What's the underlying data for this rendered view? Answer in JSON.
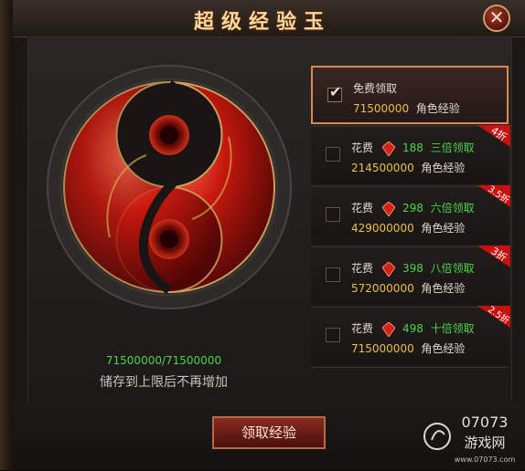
{
  "window": {
    "title": "超级经验玉",
    "close_label": "✕"
  },
  "exp_jade": {
    "progress": "71500000/71500000",
    "note": "储存到上限后不再增加"
  },
  "options": [
    {
      "selected": true,
      "line1": "免费领取",
      "amount": "71500000",
      "suffix": "角色经验"
    },
    {
      "selected": false,
      "cost_label": "花费",
      "cost": "188",
      "multiplier": "三倍领取",
      "amount": "214500000",
      "suffix": "角色经验",
      "discount": "4折"
    },
    {
      "selected": false,
      "cost_label": "花费",
      "cost": "298",
      "multiplier": "六倍领取",
      "amount": "429000000",
      "suffix": "角色经验",
      "discount": "3.5折"
    },
    {
      "selected": false,
      "cost_label": "花费",
      "cost": "398",
      "multiplier": "八倍领取",
      "amount": "572000000",
      "suffix": "角色经验",
      "discount": "3折"
    },
    {
      "selected": false,
      "cost_label": "花费",
      "cost": "498",
      "multiplier": "十倍领取",
      "amount": "715000000",
      "suffix": "角色经验",
      "discount": "2.5折"
    }
  ],
  "claim_button": "领取经验",
  "watermark": {
    "top": "07073",
    "bottom": "游戏网",
    "url": "www.07073.com"
  }
}
